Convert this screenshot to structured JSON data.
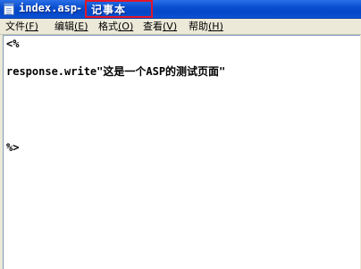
{
  "window": {
    "filename": "index.asp",
    "separator": "-",
    "app_name": "记事本"
  },
  "menu": {
    "items": [
      {
        "label": "文件",
        "accel": "(F)"
      },
      {
        "label": "编辑",
        "accel": "(E)"
      },
      {
        "label": "格式",
        "accel": "(O)"
      },
      {
        "label": "查看",
        "accel": "(V)"
      },
      {
        "label": "帮助",
        "accel": "(H)"
      }
    ]
  },
  "editor": {
    "lines": [
      "<%",
      "response.write\"这是一个ASP的测试页面\"",
      "%>"
    ]
  },
  "colors": {
    "title_bar": "#0a52d6",
    "highlight": "#e0162b",
    "menu_bg": "#ece9d8",
    "editor_bg": "#ffffff"
  }
}
